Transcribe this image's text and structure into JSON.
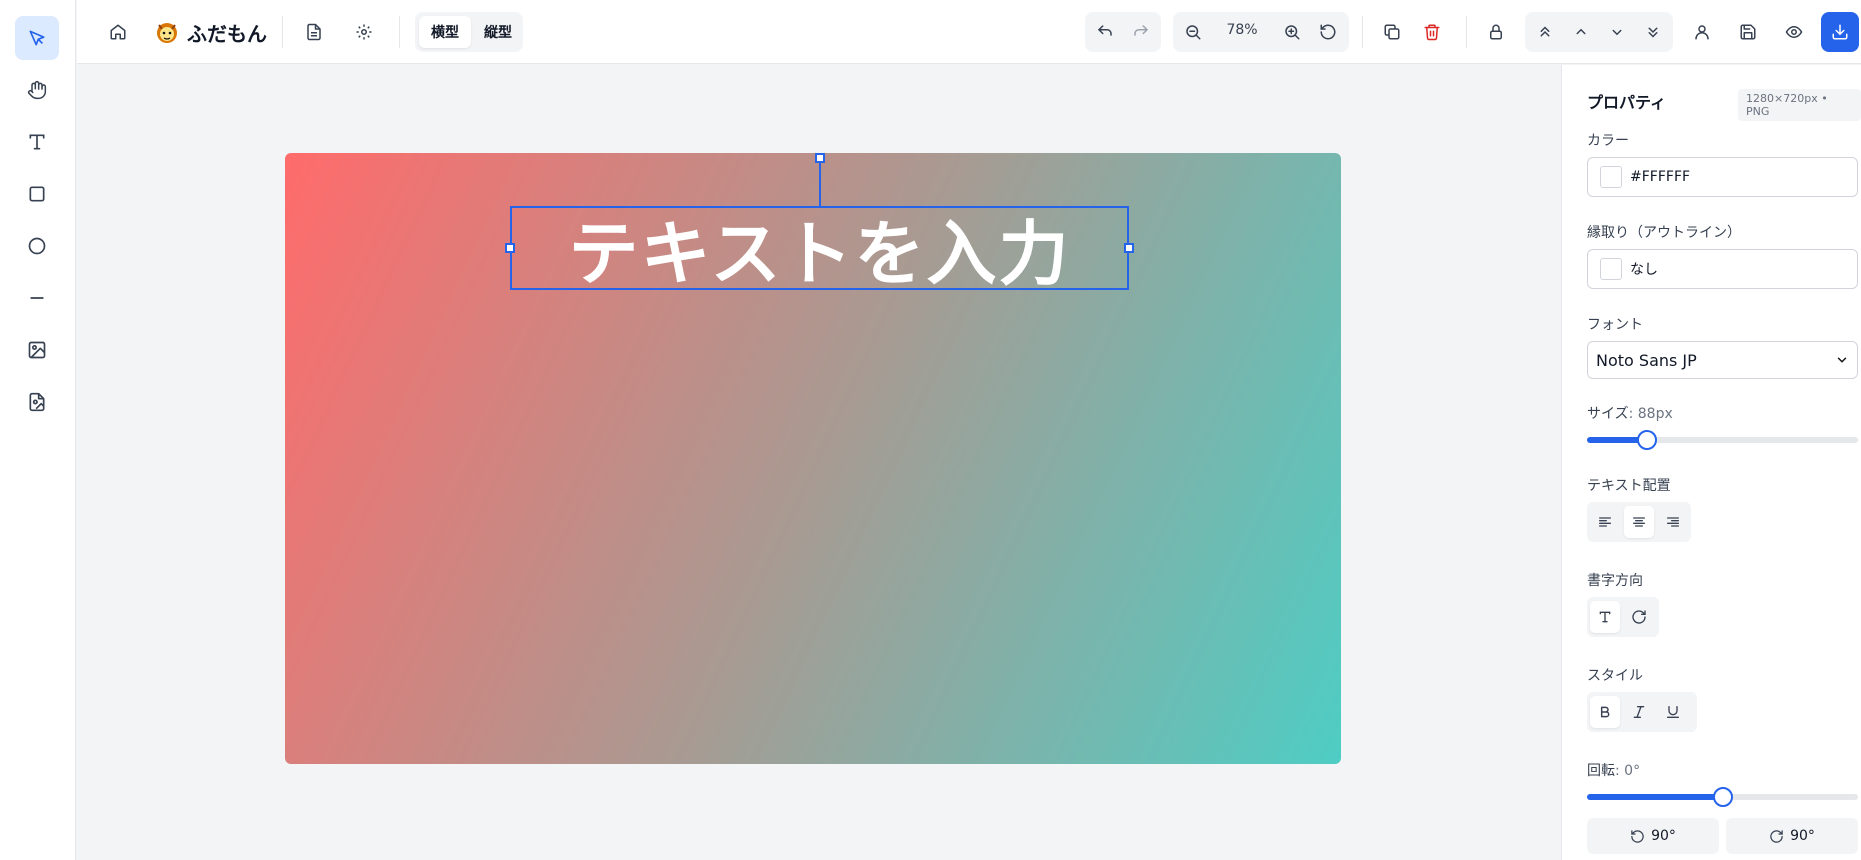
{
  "app": {
    "name": "ふだもん"
  },
  "toolbar": {
    "orientation_landscape": "横型",
    "orientation_portrait": "縦型",
    "zoom_level": "78%"
  },
  "canvas": {
    "text": "テキストを入力",
    "gradient_start": "#ff6b6b",
    "gradient_end": "#4ecdc4"
  },
  "panel": {
    "title": "プロパティ",
    "meta": "1280×720px • PNG",
    "color_label": "カラー",
    "color_value": "#FFFFFF",
    "outline_label": "縁取り（アウトライン）",
    "outline_value": "なし",
    "font_label": "フォント",
    "font_value": "Noto Sans JP",
    "size_label": "サイズ",
    "size_value": ": 88px",
    "size_percent": 22,
    "align_label": "テキスト配置",
    "direction_label": "書字方向",
    "style_label": "スタイル",
    "rotation_label": "回転",
    "rotation_value": ": 0°",
    "rotation_percent": 50,
    "rotate_left": "90°",
    "rotate_right": "90°"
  },
  "colors": {
    "accent": "#2563eb",
    "delete": "#dc2626"
  }
}
